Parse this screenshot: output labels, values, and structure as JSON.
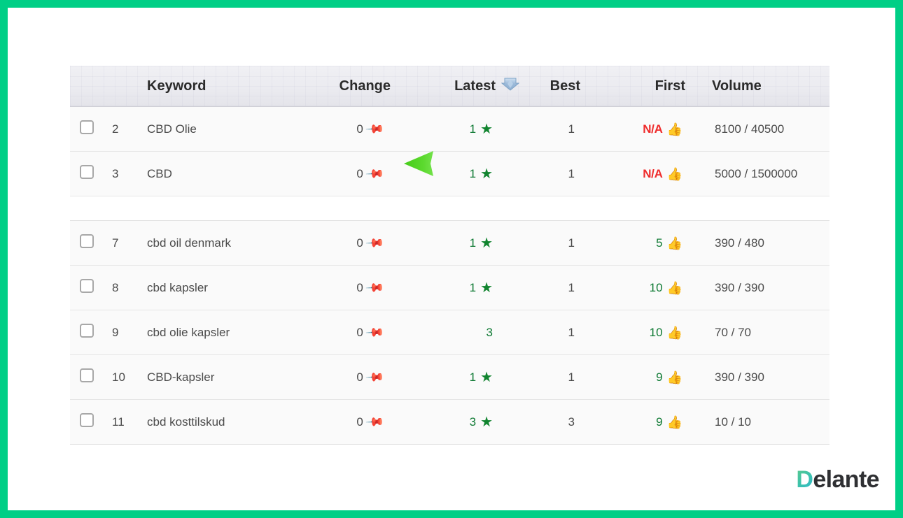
{
  "frame": {
    "border_color": "#00cf86",
    "background": "#ffffff"
  },
  "table": {
    "columns": [
      {
        "key": "select",
        "label": ""
      },
      {
        "key": "num",
        "label": ""
      },
      {
        "key": "keyword",
        "label": "Keyword"
      },
      {
        "key": "change",
        "label": "Change"
      },
      {
        "key": "latest",
        "label": "Latest",
        "sort_icon": "sort-desc-icon",
        "sorted": true
      },
      {
        "key": "best",
        "label": "Best"
      },
      {
        "key": "first",
        "label": "First"
      },
      {
        "key": "volume",
        "label": "Volume"
      }
    ],
    "groups": [
      {
        "rows": [
          {
            "num": "2",
            "keyword": "CBD Olie",
            "change": "0",
            "change_icon": "pin-icon",
            "latest": "1",
            "latest_icon": "star-icon",
            "best": "1",
            "first": "N/A",
            "first_na": true,
            "first_icon": "thumbs-up-icon",
            "volume": "8100 / 40500",
            "checked": false
          },
          {
            "num": "3",
            "keyword": "CBD",
            "change": "0",
            "change_icon": "pin-icon",
            "latest": "1",
            "latest_icon": "star-icon",
            "best": "1",
            "first": "N/A",
            "first_na": true,
            "first_icon": "thumbs-up-icon",
            "volume": "5000 / 1500000",
            "checked": false
          }
        ]
      },
      {
        "rows": [
          {
            "num": "7",
            "keyword": "cbd oil denmark",
            "change": "0",
            "change_icon": "pin-icon",
            "latest": "1",
            "latest_icon": "star-icon",
            "best": "1",
            "first": "5",
            "first_na": false,
            "first_icon": "thumbs-up-icon",
            "volume": "390 / 480",
            "checked": false
          },
          {
            "num": "8",
            "keyword": "cbd kapsler",
            "change": "0",
            "change_icon": "pin-icon",
            "latest": "1",
            "latest_icon": "star-icon",
            "best": "1",
            "first": "10",
            "first_na": false,
            "first_icon": "thumbs-up-icon",
            "volume": "390 / 390",
            "checked": false
          },
          {
            "num": "9",
            "keyword": "cbd olie kapsler",
            "change": "0",
            "change_icon": "pin-icon",
            "latest": "3",
            "latest_icon": "",
            "best": "1",
            "first": "10",
            "first_na": false,
            "first_icon": "thumbs-up-icon",
            "volume": "70 / 70",
            "checked": false
          },
          {
            "num": "10",
            "keyword": "CBD-kapsler",
            "change": "0",
            "change_icon": "pin-icon",
            "latest": "1",
            "latest_icon": "star-icon",
            "best": "1",
            "first": "9",
            "first_na": false,
            "first_icon": "thumbs-up-icon",
            "volume": "390 / 390",
            "checked": false
          },
          {
            "num": "11",
            "keyword": "cbd kosttilskud",
            "change": "0",
            "change_icon": "pin-icon",
            "latest": "3",
            "latest_icon": "star-icon",
            "best": "3",
            "first": "9",
            "first_na": false,
            "first_icon": "thumbs-up-icon",
            "volume": "10 / 10",
            "checked": false
          }
        ]
      }
    ]
  },
  "annotation": {
    "type": "arrow",
    "direction": "left",
    "color": "#4fd520",
    "points_at_row": "2"
  },
  "logo": {
    "first_letter": "D",
    "rest": "elante",
    "gradient_from": "#5ec98a",
    "gradient_to": "#2ab7d4"
  },
  "colors": {
    "frame_green": "#00cf86",
    "arrow_green": "#4fd520",
    "star_green": "#11842f",
    "thumb_green": "#3fae3f",
    "na_red": "#ef2b2b",
    "header_bg": "#ebebf0",
    "row_bg": "#fafafa"
  }
}
